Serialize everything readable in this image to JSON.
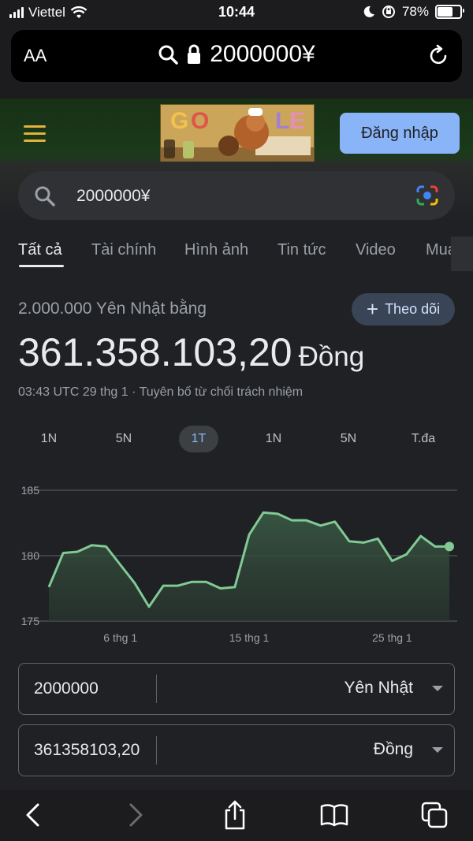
{
  "status_bar": {
    "carrier": "Viettel",
    "time": "10:44",
    "battery": "78%",
    "battery_level": 0.78
  },
  "browser": {
    "text_size_label": "AA",
    "url": "2000000¥"
  },
  "header": {
    "sign_in": "Đăng nhập"
  },
  "search": {
    "query": "2000000¥"
  },
  "tabs": [
    {
      "label": "Tất cả",
      "active": true
    },
    {
      "label": "Tài chính"
    },
    {
      "label": "Hình ảnh"
    },
    {
      "label": "Tin tức"
    },
    {
      "label": "Video"
    },
    {
      "label": "Mua s"
    }
  ],
  "converter": {
    "from_label": "2.000.000 Yên Nhật bằng",
    "follow_label": "Theo dõi",
    "result_value": "361.358.103,20",
    "result_currency": "Đồng",
    "timestamp": "03:43 UTC 29 thg 1 · Tuyên bố từ chối trách nhiệm",
    "ranges": [
      "1N",
      "5N",
      "1T",
      "1N",
      "5N",
      "T.đa"
    ],
    "active_range": "1T",
    "from_amount": "2000000",
    "from_unit": "Yên Nhật",
    "to_amount": "361358103,20",
    "to_unit": "Đồng"
  },
  "chart_data": {
    "type": "area",
    "ylim": [
      175,
      185
    ],
    "yticks": [
      175,
      180,
      185
    ],
    "xlim": [
      1,
      29
    ],
    "xtick_values": [
      6,
      15,
      25
    ],
    "xtick_labels": [
      "6 thg 1",
      "15 thg 1",
      "25 thg 1"
    ],
    "grid": true,
    "x": [
      1,
      2,
      3,
      4,
      5,
      6,
      7,
      8,
      9,
      10,
      11,
      12,
      13,
      14,
      15,
      16,
      17,
      18,
      19,
      20,
      21,
      22,
      23,
      24,
      25,
      26,
      27,
      28,
      29
    ],
    "values": [
      177.6,
      180.2,
      180.3,
      180.8,
      180.7,
      179.3,
      177.9,
      176.1,
      177.7,
      177.7,
      178.0,
      178.0,
      177.5,
      177.6,
      181.6,
      183.3,
      183.2,
      182.7,
      182.7,
      182.3,
      182.6,
      181.1,
      181.0,
      181.3,
      179.6,
      180.1,
      181.5,
      180.7,
      180.7
    ],
    "line_color": "#81c995"
  }
}
